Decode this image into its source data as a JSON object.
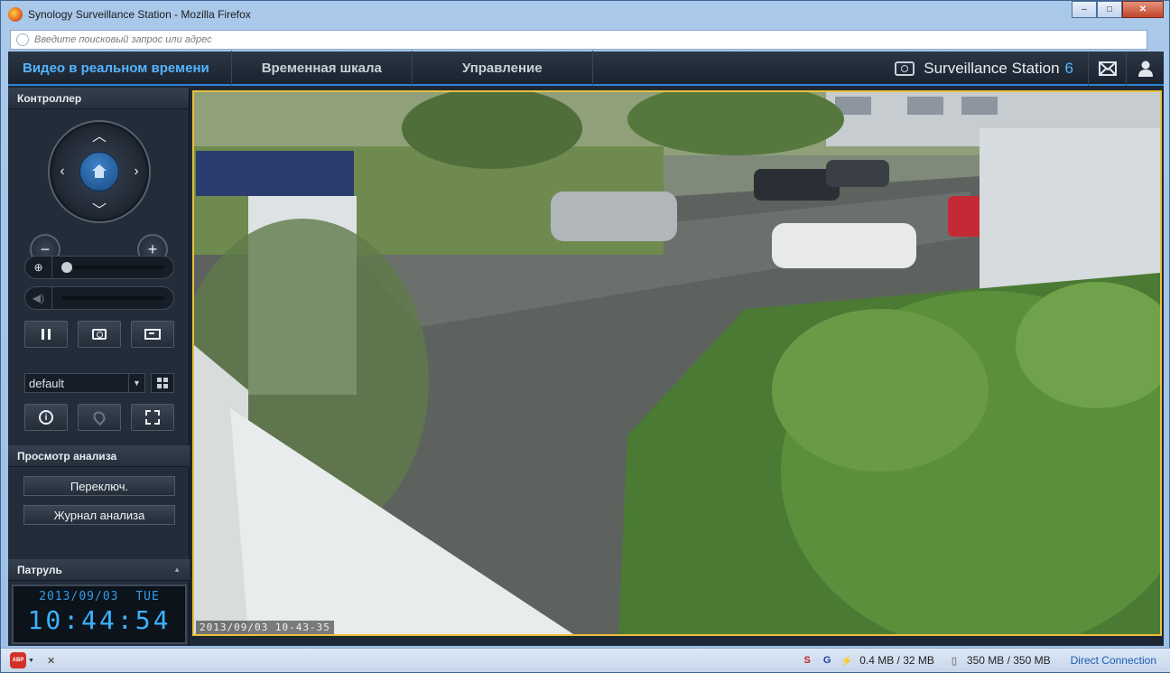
{
  "window": {
    "title": "Synology Surveillance Station - Mozilla Firefox",
    "buttons": {
      "minimize": "–",
      "maximize": "□",
      "close": "✕"
    }
  },
  "urlbar": {
    "placeholder": "Введите поисковый запрос или адрес"
  },
  "nav": {
    "tabs": [
      "Видео в реальном времени",
      "Временная шкала",
      "Управление"
    ],
    "app_name": "Surveillance Station",
    "app_version": "6",
    "accent_color": "#54b4ff"
  },
  "sidebar": {
    "controller_title": "Контроллер",
    "zoom_out": "−",
    "zoom_in": "+",
    "zoom_level": 0,
    "volume_level": 0,
    "layout_value": "default",
    "analysis_title": "Просмотр анализа",
    "toggle_button": "Переключ.",
    "analysis_log_button": "Журнал анализа",
    "patrol_title": "Патруль",
    "clock_date": "2013/09/03",
    "clock_day": "TUE",
    "clock_time": "10:44:54"
  },
  "video": {
    "timestamp": "2013/09/03 10-43-35",
    "border_color": "#e8c13a"
  },
  "statusbar": {
    "abp_label": "ABP",
    "close": "✕",
    "network_usage": "0.4 MB / 32 MB",
    "memory_usage": "350 MB / 350 MB",
    "connection": "Direct Connection"
  }
}
